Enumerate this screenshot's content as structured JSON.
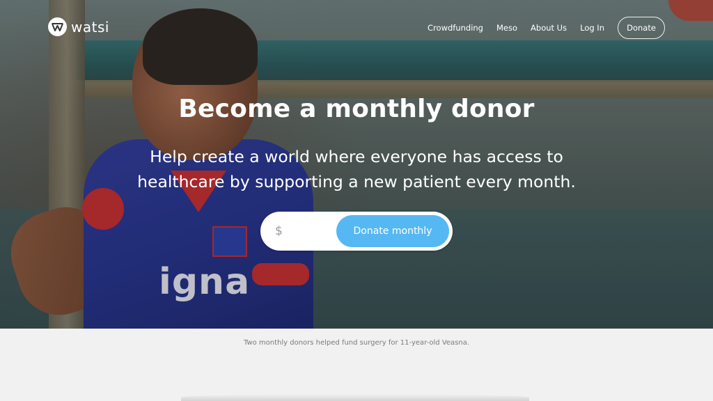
{
  "brand": {
    "name": "watsi",
    "logo_icon": "watsi-w-logo-icon"
  },
  "nav": {
    "links": [
      {
        "label": "Crowdfunding"
      },
      {
        "label": "Meso"
      },
      {
        "label": "About Us"
      },
      {
        "label": "Log In"
      }
    ],
    "donate_label": "Donate"
  },
  "hero": {
    "title": "Become a monthly donor",
    "subtitle": "Help create a world where everyone has access to healthcare by supporting a new patient every month.",
    "shirt_text": "igna",
    "form": {
      "currency_symbol": "$",
      "amount_value": "",
      "submit_label": "Donate monthly"
    }
  },
  "caption": "Two monthly donors helped fund surgery for 11-year-old Veasna.",
  "colors": {
    "accent": "#56b8f3",
    "caption_bg": "#f1f1f1",
    "text_light": "#ffffff"
  }
}
